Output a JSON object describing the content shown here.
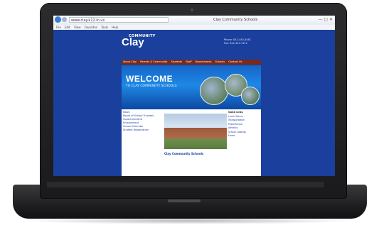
{
  "browser": {
    "address": "www.clay.k12.in.us",
    "tab_title": "Clay Community Schools",
    "window_controls": "— ▢ ✕",
    "menu": [
      "File",
      "Edit",
      "View",
      "Favorites",
      "Tools",
      "Help"
    ]
  },
  "site": {
    "logo_small": "COMMUNITY",
    "logo_big": "Clay",
    "contact": [
      "Phone: 812-443-4461",
      "Fax: 812-443-7212"
    ],
    "nav": [
      "About Clay",
      "Parents & Community",
      "Students",
      "Staff",
      "Departments",
      "Schools",
      "Contact Us"
    ],
    "banner_title": "WELCOME",
    "banner_subtitle": "TO CLAY COMMUNITY SCHOOLS",
    "left_column": [
      "News",
      "Board of School Trustees",
      "Superintendent",
      "Employment",
      "School Calendar",
      "Student Registration"
    ],
    "photo_caption": "Clay Community Schools",
    "right_column_heading": "Quick Links",
    "right_column": [
      "Lunch Menus",
      "Transportation",
      "PowerSchool",
      "Athletics",
      "School Closings",
      "Forms"
    ]
  },
  "colors": {
    "site_blue": "#1a3f9c",
    "nav_red": "#7a2a1c",
    "laptop_body": "#1f1f21"
  }
}
